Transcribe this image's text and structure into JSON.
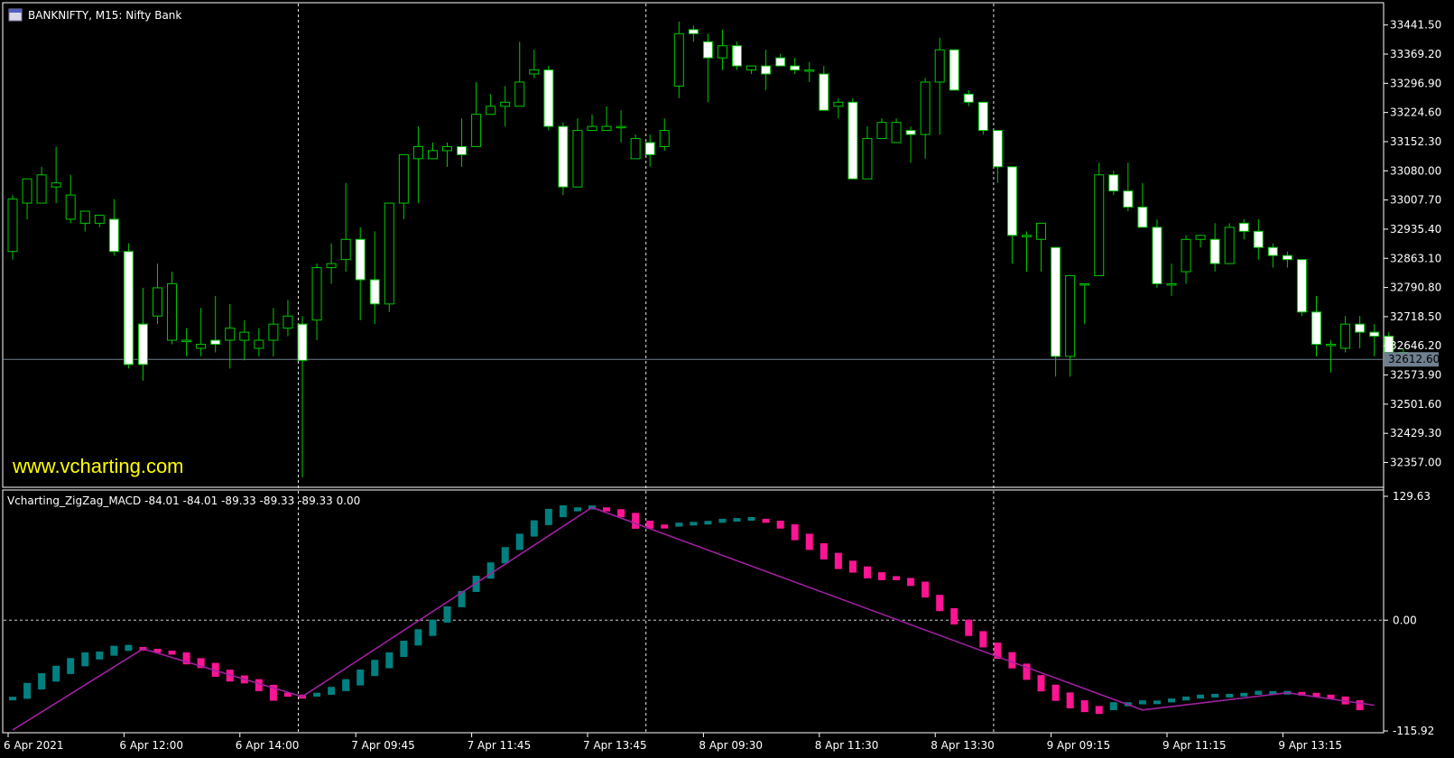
{
  "header": {
    "symbol_label": "BANKNIFTY, M15:  Nifty Bank"
  },
  "watermark": "www.vcharting.com",
  "indicator": {
    "label": "Vcharting_ZigZag_MACD -84.01 -84.01 -89.33 -89.33 -89.33 0.00"
  },
  "colors": {
    "background": "#000000",
    "frame": "#ffffff",
    "candle_outline": "#00c800",
    "candle_bull_body": "#000000",
    "candle_bear_body": "#ffffff",
    "grid_line": "#ffffff",
    "price_line": "#708090",
    "macd_rising": "#008080",
    "macd_falling": "#ff1493",
    "zigzag": "#a020a0",
    "watermark": "#ffff00"
  },
  "chart_data": [
    {
      "type": "candlestick",
      "title": "BANKNIFTY, M15:  Nifty Bank",
      "ylim": [
        32300,
        33490
      ],
      "y_ticks": [
        "33441.50",
        "33369.20",
        "33296.90",
        "33224.60",
        "33152.30",
        "33080.00",
        "33007.70",
        "32935.40",
        "32863.10",
        "32790.80",
        "32718.50",
        "32646.20",
        "32573.90",
        "32501.60",
        "32429.30",
        "32357.00"
      ],
      "x_ticks": [
        {
          "index": 0,
          "label": "6 Apr 2021"
        },
        {
          "index": 8,
          "label": "6 Apr 12:00"
        },
        {
          "index": 16,
          "label": "6 Apr 14:00"
        },
        {
          "index": 24,
          "label": "7 Apr 09:45"
        },
        {
          "index": 32,
          "label": "7 Apr 11:45"
        },
        {
          "index": 40,
          "label": "7 Apr 13:45"
        },
        {
          "index": 48,
          "label": "8 Apr 09:30"
        },
        {
          "index": 56,
          "label": "8 Apr 11:30"
        },
        {
          "index": 64,
          "label": "8 Apr 13:30"
        },
        {
          "index": 72,
          "label": "9 Apr 09:15"
        },
        {
          "index": 80,
          "label": "9 Apr 11:15"
        },
        {
          "index": 88,
          "label": "9 Apr 13:15"
        }
      ],
      "current_price": "32612.60",
      "candles": [
        [
          32880,
          33020,
          32860,
          33010
        ],
        [
          33000,
          33050,
          32960,
          33060
        ],
        [
          33000,
          33090,
          33010,
          33070
        ],
        [
          33040,
          33140,
          33000,
          33050
        ],
        [
          32960,
          33070,
          32950,
          33020
        ],
        [
          32950,
          32980,
          32930,
          32980
        ],
        [
          32950,
          32970,
          32940,
          32970
        ],
        [
          32960,
          33010,
          32870,
          32880
        ],
        [
          32880,
          32900,
          32590,
          32600
        ],
        [
          32700,
          32790,
          32560,
          32600
        ],
        [
          32720,
          32850,
          32700,
          32790
        ],
        [
          32660,
          32830,
          32650,
          32800
        ],
        [
          32660,
          32690,
          32620,
          32660
        ],
        [
          32640,
          32740,
          32620,
          32650
        ],
        [
          32660,
          32770,
          32630,
          32650
        ],
        [
          32660,
          32750,
          32590,
          32690
        ],
        [
          32660,
          32710,
          32610,
          32680
        ],
        [
          32640,
          32690,
          32620,
          32660
        ],
        [
          32660,
          32740,
          32620,
          32700
        ],
        [
          32690,
          32760,
          32670,
          32720
        ],
        [
          32700,
          32720,
          32320,
          32610
        ],
        [
          32710,
          32850,
          32660,
          32840
        ],
        [
          32840,
          32900,
          32800,
          32850
        ],
        [
          32860,
          33050,
          32830,
          32910
        ],
        [
          32910,
          32940,
          32710,
          32810
        ],
        [
          32810,
          32930,
          32700,
          32750
        ],
        [
          32750,
          33000,
          32730,
          33000
        ],
        [
          33000,
          33110,
          32960,
          33120
        ],
        [
          33110,
          33190,
          33000,
          33140
        ],
        [
          33110,
          33150,
          33110,
          33130
        ],
        [
          33130,
          33150,
          33090,
          33140
        ],
        [
          33140,
          33210,
          33090,
          33120
        ],
        [
          33140,
          33300,
          33140,
          33220
        ],
        [
          33220,
          33270,
          33220,
          33240
        ],
        [
          33240,
          33290,
          33190,
          33250
        ],
        [
          33240,
          33400,
          33240,
          33300
        ],
        [
          33320,
          33380,
          33310,
          33330
        ],
        [
          33330,
          33340,
          33180,
          33190
        ],
        [
          33190,
          33200,
          33020,
          33040
        ],
        [
          33040,
          33210,
          33040,
          33180
        ],
        [
          33180,
          33220,
          33180,
          33190
        ],
        [
          33180,
          33240,
          33180,
          33190
        ],
        [
          33190,
          33230,
          33150,
          33190
        ],
        [
          33110,
          33170,
          33110,
          33160
        ],
        [
          33150,
          33170,
          33090,
          33120
        ],
        [
          33140,
          33210,
          33130,
          33180
        ],
        [
          33290,
          33450,
          33260,
          33420
        ],
        [
          33430,
          33440,
          33400,
          33420
        ],
        [
          33400,
          33420,
          33250,
          33360
        ],
        [
          33360,
          33430,
          33330,
          33390
        ],
        [
          33390,
          33400,
          33330,
          33340
        ],
        [
          33330,
          33340,
          33320,
          33340
        ],
        [
          33340,
          33380,
          33280,
          33320
        ],
        [
          33360,
          33370,
          33340,
          33340
        ],
        [
          33340,
          33360,
          33320,
          33330
        ],
        [
          33330,
          33350,
          33300,
          33330
        ],
        [
          33320,
          33340,
          33230,
          33230
        ],
        [
          33240,
          33260,
          33210,
          33250
        ],
        [
          33250,
          33260,
          33060,
          33060
        ],
        [
          33060,
          33190,
          33060,
          33160
        ],
        [
          33160,
          33210,
          33170,
          33200
        ],
        [
          33150,
          33210,
          33150,
          33200
        ],
        [
          33180,
          33190,
          33100,
          33170
        ],
        [
          33170,
          33310,
          33110,
          33300
        ],
        [
          33300,
          33410,
          33170,
          33380
        ],
        [
          33380,
          33380,
          33290,
          33280
        ],
        [
          33270,
          33280,
          33240,
          33250
        ],
        [
          33250,
          33250,
          33170,
          33180
        ],
        [
          33180,
          33180,
          33050,
          33090
        ],
        [
          33090,
          33090,
          32850,
          32920
        ],
        [
          32920,
          32930,
          32830,
          32920
        ],
        [
          32910,
          32950,
          32830,
          32950
        ],
        [
          32890,
          32890,
          32570,
          32620
        ],
        [
          32620,
          32800,
          32570,
          32820
        ],
        [
          32800,
          32800,
          32700,
          32800
        ],
        [
          32820,
          33100,
          32820,
          33070
        ],
        [
          33070,
          33080,
          33020,
          33030
        ],
        [
          33030,
          33100,
          32980,
          32990
        ],
        [
          32990,
          33050,
          32960,
          32940
        ],
        [
          32940,
          32960,
          32790,
          32800
        ],
        [
          32800,
          32850,
          32770,
          32800
        ],
        [
          32830,
          32920,
          32800,
          32910
        ],
        [
          32910,
          32920,
          32890,
          32920
        ],
        [
          32910,
          32950,
          32830,
          32850
        ],
        [
          32850,
          32950,
          32850,
          32940
        ],
        [
          32950,
          32960,
          32910,
          32930
        ],
        [
          32930,
          32960,
          32860,
          32890
        ],
        [
          32890,
          32900,
          32840,
          32870
        ],
        [
          32870,
          32880,
          32840,
          32860
        ],
        [
          32860,
          32860,
          32720,
          32730
        ],
        [
          32730,
          32770,
          32620,
          32650
        ],
        [
          32650,
          32660,
          32580,
          32650
        ],
        [
          32640,
          32720,
          32630,
          32700
        ],
        [
          32700,
          32720,
          32640,
          32680
        ],
        [
          32680,
          32700,
          32620,
          32670
        ],
        [
          32670,
          32680,
          32610,
          32630
        ],
        [
          32630,
          32640,
          32610,
          32620
        ]
      ]
    },
    {
      "type": "bar",
      "title": "Vcharting_ZigZag_MACD -84.01 -84.01 -89.33 -89.33 -89.33 0.00",
      "ylim": [
        -115.92,
        129.63
      ],
      "y_ticks": [
        "129.63",
        "0.00",
        "-115.92"
      ],
      "zero_line": true,
      "histogram": [
        -82,
        -74,
        -64,
        -56,
        -48,
        -41,
        -37,
        -32,
        -29,
        -30,
        -32,
        -34,
        -40,
        -45,
        -52,
        -58,
        -62,
        -68,
        -76,
        -78,
        -80,
        -78,
        -74,
        -68,
        -60,
        -50,
        -42,
        -30,
        -18,
        -8,
        6,
        22,
        38,
        52,
        68,
        82,
        96,
        108,
        114,
        116,
        118,
        116,
        112,
        104,
        100,
        98,
        100,
        101,
        102,
        104,
        105,
        106,
        104,
        100,
        92,
        82,
        72,
        62,
        56,
        50,
        46,
        44,
        40,
        32,
        18,
        4,
        -8,
        -20,
        -32,
        -42,
        -54,
        -66,
        -76,
        -84,
        -90,
        -94,
        -90,
        -88,
        -86,
        -86,
        -84,
        -82,
        -80,
        -79,
        -79,
        -78,
        -76,
        -76,
        -76,
        -77,
        -78,
        -80,
        -84,
        -89
      ],
      "zigzag": [
        {
          "index": 0,
          "value": -115
        },
        {
          "index": 9,
          "value": -30
        },
        {
          "index": 20,
          "value": -80
        },
        {
          "index": 40,
          "value": 118
        },
        {
          "index": 78,
          "value": -94
        },
        {
          "index": 88,
          "value": -76
        },
        {
          "index": 94,
          "value": -89
        }
      ]
    }
  ]
}
